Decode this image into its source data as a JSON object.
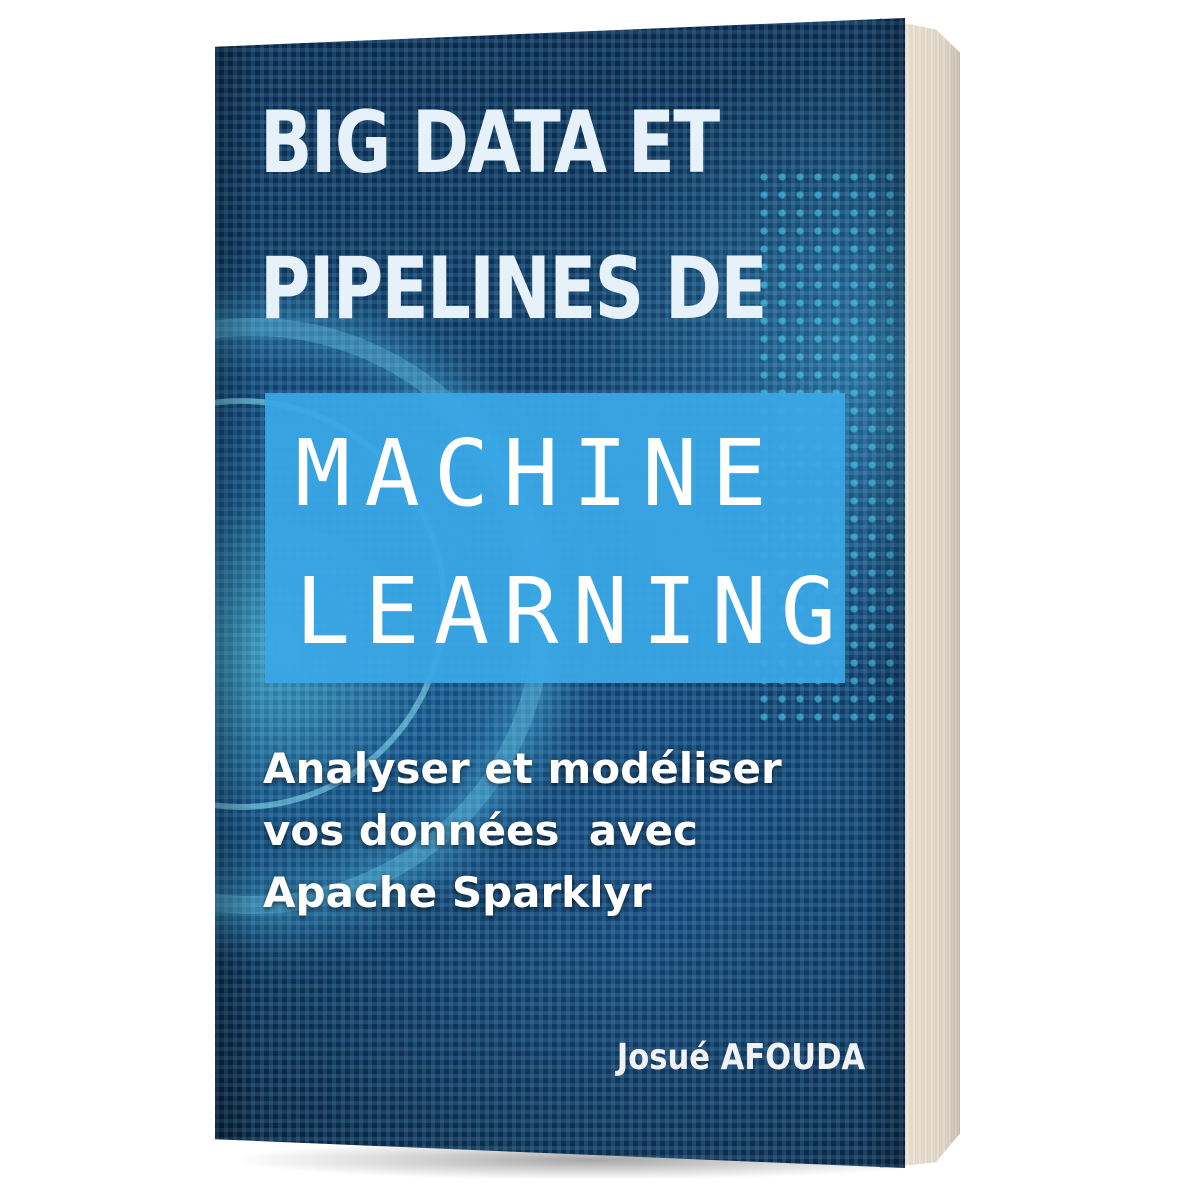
{
  "book": {
    "title_line1": "BIG  DATA ET",
    "title_line2": "PIPELINES DE",
    "highlight_line1": "MACHINE",
    "highlight_line2": "LEARNING",
    "subtitle_line1": "Analyser et modéliser",
    "subtitle_line2": "vos données  avec",
    "subtitle_line3": "Apache Sparklyr",
    "author": "Josué AFOUDA"
  },
  "colors": {
    "cover_background": "#0f3a64",
    "highlight_box": "#3aa6e6",
    "title_text": "#e7f1f9",
    "page_edges": "#efe6d9"
  }
}
